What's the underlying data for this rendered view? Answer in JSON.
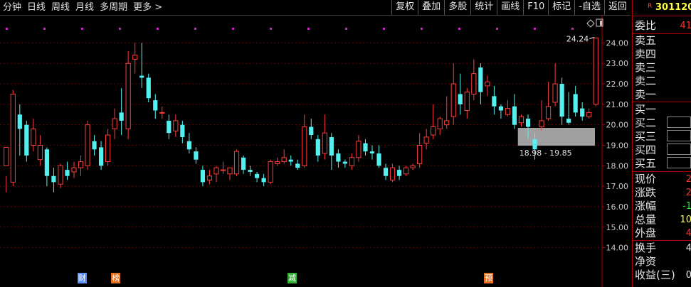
{
  "toolbar": {
    "periods": [
      "分钟",
      "日线",
      "周线",
      "月线",
      "多周期",
      "更多 >"
    ],
    "actions": [
      "复权",
      "叠加",
      "多股",
      "统计",
      "画线",
      "F10",
      "标记",
      "-自选",
      "返回"
    ]
  },
  "stock": {
    "market_badge": "R",
    "code": "301120"
  },
  "quote_panel": {
    "ratio_label": "委比",
    "ratio_value": "41",
    "sell_levels": [
      "卖五",
      "卖四",
      "卖三",
      "卖二",
      "卖一"
    ],
    "buy_levels": [
      "买一",
      "买二",
      "买三",
      "买四",
      "买五"
    ],
    "stats": [
      {
        "label": "现价",
        "value": "2"
      },
      {
        "label": "涨跌",
        "value": "2"
      },
      {
        "label": "涨幅",
        "value": "-1"
      },
      {
        "label": "总量",
        "value": "10"
      },
      {
        "label": "外盘",
        "value": "4"
      },
      {
        "label": "换手",
        "value": "4"
      },
      {
        "label": "净资",
        "value": ""
      },
      {
        "label": "收益(三)",
        "value": "0"
      }
    ]
  },
  "chart_data": {
    "type": "candlestick",
    "y_ticks": [
      "24.00",
      "23.00",
      "22.00",
      "21.00",
      "20.00",
      "19.00",
      "18.00",
      "17.00",
      "16.00",
      "15.00",
      "14.00"
    ],
    "ylim": [
      13.5,
      24.5
    ],
    "annotations": {
      "high_label": "24.24",
      "gap_label": "18.98 - 19.85"
    },
    "gap_zone": [
      18.98,
      19.85
    ],
    "event_tags": [
      {
        "text": "财",
        "index": 11,
        "color": "#5b8ff9"
      },
      {
        "text": "榜",
        "index": 16,
        "color": "#e07020"
      },
      {
        "text": "减",
        "index": 42,
        "color": "#30b030"
      },
      {
        "text": "预",
        "index": 71,
        "color": "#e07020"
      }
    ],
    "candles": [
      [
        18.0,
        18.9,
        17.5,
        16.7
      ],
      [
        17.2,
        21.5,
        21.7,
        17.0
      ],
      [
        20.5,
        19.8,
        21.0,
        18.5
      ],
      [
        20.0,
        18.5,
        20.2,
        18.2
      ],
      [
        19.0,
        19.8,
        20.3,
        18.7
      ],
      [
        18.3,
        19.0,
        19.5,
        18.0
      ],
      [
        18.8,
        17.5,
        18.9,
        17.0
      ],
      [
        17.5,
        17.2,
        17.9,
        16.7
      ],
      [
        17.1,
        18.0,
        18.1,
        16.9
      ],
      [
        17.8,
        17.5,
        18.2,
        17.3
      ],
      [
        17.7,
        17.9,
        18.2,
        17.4
      ],
      [
        17.9,
        18.2,
        18.5,
        17.5
      ],
      [
        18.0,
        20.0,
        20.2,
        17.8
      ],
      [
        19.2,
        18.8,
        19.5,
        18.5
      ],
      [
        18.9,
        18.0,
        19.2,
        17.8
      ],
      [
        18.2,
        19.5,
        19.8,
        18.0
      ],
      [
        19.8,
        20.3,
        20.8,
        19.3
      ],
      [
        20.6,
        20.2,
        21.8,
        19.5
      ],
      [
        19.8,
        23.0,
        23.6,
        19.3
      ],
      [
        23.2,
        23.4,
        24.0,
        22.5
      ],
      [
        22.4,
        22.3,
        24.0,
        21.8
      ],
      [
        22.3,
        21.3,
        22.5,
        21.1
      ],
      [
        21.2,
        20.7,
        21.5,
        20.3
      ],
      [
        20.6,
        20.6,
        20.9,
        20.3
      ],
      [
        20.2,
        19.6,
        20.5,
        19.3
      ],
      [
        19.7,
        20.2,
        20.5,
        19.4
      ],
      [
        20.0,
        19.4,
        20.2,
        19.1
      ],
      [
        19.2,
        18.8,
        19.6,
        18.6
      ],
      [
        18.7,
        18.3,
        18.9,
        18.1
      ],
      [
        17.8,
        17.2,
        18.0,
        17.0
      ],
      [
        17.3,
        17.5,
        17.8,
        17.1
      ],
      [
        17.6,
        17.9,
        18.0,
        17.2
      ],
      [
        17.8,
        17.8,
        18.2,
        17.6
      ],
      [
        17.6,
        17.9,
        17.9,
        17.3
      ],
      [
        17.6,
        18.7,
        18.8,
        17.5
      ],
      [
        18.4,
        17.8,
        18.5,
        17.6
      ],
      [
        17.8,
        17.7,
        18.0,
        17.5
      ],
      [
        17.6,
        17.4,
        17.7,
        17.2
      ],
      [
        17.4,
        17.2,
        17.6,
        17.0
      ],
      [
        17.2,
        18.2,
        18.3,
        17.1
      ],
      [
        18.1,
        18.2,
        18.4,
        18.0
      ],
      [
        18.2,
        18.4,
        18.8,
        18.1
      ],
      [
        18.3,
        18.2,
        18.5,
        18.0
      ],
      [
        18.1,
        17.9,
        18.3,
        17.8
      ],
      [
        18.0,
        19.9,
        20.5,
        17.9
      ],
      [
        19.9,
        19.5,
        20.3,
        19.3
      ],
      [
        19.3,
        18.5,
        19.5,
        18.2
      ],
      [
        18.6,
        19.6,
        20.5,
        18.3
      ],
      [
        19.4,
        18.5,
        19.6,
        17.8
      ],
      [
        18.6,
        18.2,
        18.8,
        17.9
      ],
      [
        18.2,
        18.1,
        18.3,
        17.9
      ],
      [
        18.0,
        18.4,
        18.6,
        17.8
      ],
      [
        18.4,
        19.2,
        19.5,
        18.2
      ],
      [
        19.1,
        18.7,
        19.3,
        18.5
      ],
      [
        18.7,
        18.6,
        19.0,
        18.3
      ],
      [
        18.6,
        18.0,
        19.0,
        17.9
      ],
      [
        17.9,
        17.5,
        18.1,
        17.3
      ],
      [
        17.3,
        17.9,
        18.1,
        17.2
      ],
      [
        17.8,
        17.5,
        18.0,
        17.3
      ],
      [
        17.6,
        17.9,
        18.0,
        17.5
      ],
      [
        17.9,
        18.0,
        18.1,
        17.8
      ],
      [
        18.1,
        19.0,
        19.6,
        17.9
      ],
      [
        19.1,
        19.4,
        19.8,
        18.8
      ],
      [
        19.5,
        19.9,
        21.0,
        19.3
      ],
      [
        19.8,
        20.3,
        20.4,
        19.5
      ],
      [
        20.0,
        20.2,
        21.4,
        19.8
      ],
      [
        20.4,
        22.0,
        23.0,
        20.0
      ],
      [
        21.5,
        21.0,
        22.5,
        20.5
      ],
      [
        20.7,
        21.6,
        21.8,
        20.3
      ],
      [
        21.5,
        22.5,
        23.2,
        21.2
      ],
      [
        22.8,
        21.6,
        23.0,
        21.0
      ],
      [
        21.9,
        22.1,
        22.4,
        21.4
      ],
      [
        21.4,
        20.9,
        21.9,
        20.5
      ],
      [
        20.9,
        20.7,
        21.0,
        20.3
      ],
      [
        20.5,
        20.8,
        21.2,
        20.4
      ],
      [
        20.9,
        20.0,
        21.5,
        19.8
      ],
      [
        20.1,
        20.4,
        20.5,
        19.9
      ],
      [
        20.3,
        19.9,
        20.5,
        19.3
      ],
      [
        19.3,
        18.8,
        19.6,
        18.3
      ],
      [
        19.9,
        20.2,
        21.2,
        19.7
      ],
      [
        20.3,
        20.9,
        22.1,
        20.2
      ],
      [
        21.1,
        22.0,
        23.0,
        20.9
      ],
      [
        22.0,
        20.4,
        22.3,
        20.0
      ],
      [
        20.3,
        20.1,
        21.6,
        20.0
      ],
      [
        21.5,
        20.6,
        21.9,
        20.4
      ],
      [
        20.8,
        20.4,
        21.1,
        20.2
      ],
      [
        20.4,
        20.6,
        20.8,
        20.3
      ],
      [
        21.0,
        24.24,
        24.24,
        20.9
      ]
    ]
  }
}
